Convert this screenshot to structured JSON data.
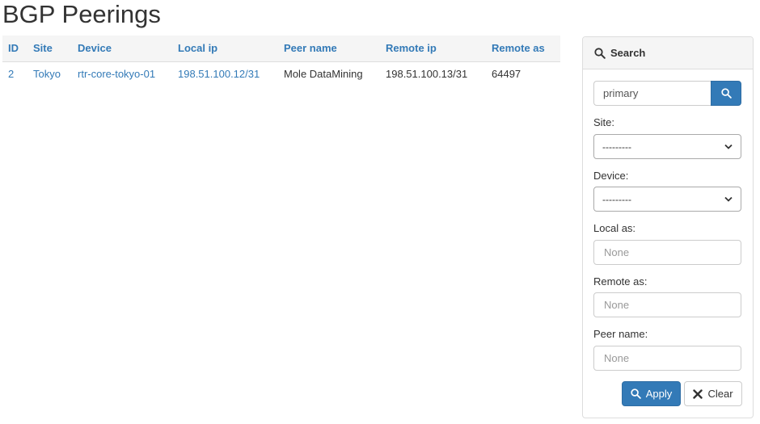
{
  "page": {
    "title": "BGP Peerings"
  },
  "table": {
    "columns": [
      "ID",
      "Site",
      "Device",
      "Local ip",
      "Peer name",
      "Remote ip",
      "Remote as"
    ],
    "rows": [
      {
        "id": "2",
        "site": "Tokyo",
        "device": "rtr-core-tokyo-01",
        "local_ip": "198.51.100.12/31",
        "peer_name": "Mole DataMining",
        "remote_ip": "198.51.100.13/31",
        "remote_as": "64497"
      }
    ]
  },
  "search_panel": {
    "title": "Search",
    "query_value": "primary",
    "fields": {
      "site": {
        "label": "Site:",
        "value": "---------"
      },
      "device": {
        "label": "Device:",
        "value": "---------"
      },
      "local_as": {
        "label": "Local as:",
        "placeholder": "None"
      },
      "remote_as": {
        "label": "Remote as:",
        "placeholder": "None"
      },
      "peer_name": {
        "label": "Peer name:",
        "placeholder": "None"
      }
    },
    "apply_label": "Apply",
    "clear_label": "Clear"
  },
  "colors": {
    "link": "#337ab7",
    "primary_button": "#337ab7",
    "header_bg": "#f5f5f5",
    "border": "#dddddd"
  },
  "icons": {
    "search": "magnifier-icon",
    "select_arrow": "chevron-down-icon",
    "clear": "close-icon"
  }
}
